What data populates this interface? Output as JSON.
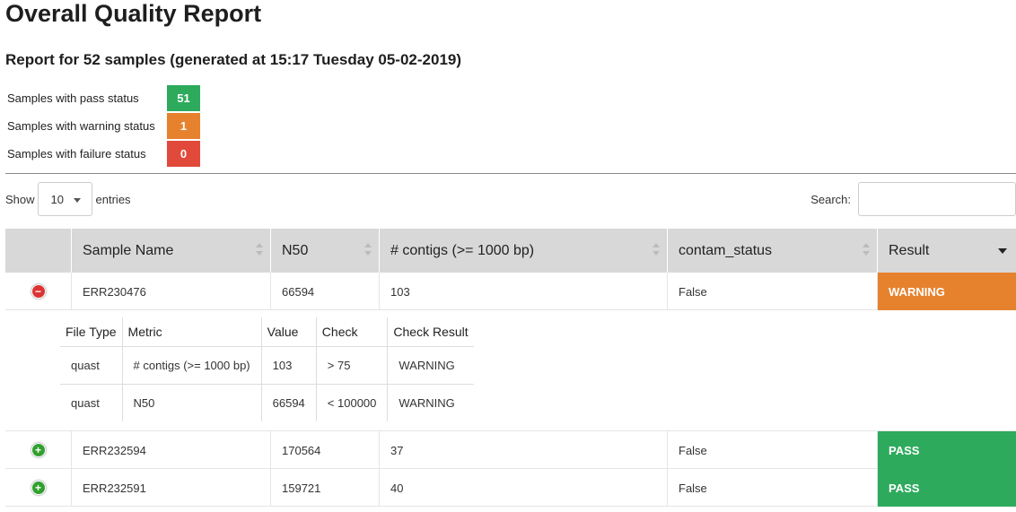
{
  "page": {
    "title": "Overall Quality Report",
    "subtitle": "Report for 52 samples (generated at 15:17 Tuesday 05-02-2019)"
  },
  "summary": [
    {
      "label": "Samples with pass status",
      "count": "51",
      "color": "#2eaa5d"
    },
    {
      "label": "Samples with warning status",
      "count": "1",
      "color": "#e6822e"
    },
    {
      "label": "Samples with failure status",
      "count": "0",
      "color": "#e14a3b"
    }
  ],
  "controls": {
    "show_label": "Show",
    "page_length": "10",
    "entries_label": "entries",
    "search_label": "Search:",
    "search_value": ""
  },
  "table": {
    "columns": [
      "",
      "Sample Name",
      "N50",
      "# contigs (>= 1000 bp)",
      "contam_status",
      "Result"
    ],
    "sorted_column": "Result",
    "rows": [
      {
        "toggle": "−",
        "sample": "ERR230476",
        "n50": "66594",
        "contigs": "103",
        "contam": "False",
        "result": "WARNING",
        "result_color": "#e6822e",
        "expanded": true
      },
      {
        "toggle": "+",
        "sample": "ERR232594",
        "n50": "170564",
        "contigs": "37",
        "contam": "False",
        "result": "PASS",
        "result_color": "#2eaa5d",
        "expanded": false
      },
      {
        "toggle": "+",
        "sample": "ERR232591",
        "n50": "159721",
        "contigs": "40",
        "contam": "False",
        "result": "PASS",
        "result_color": "#2eaa5d",
        "expanded": false
      }
    ]
  },
  "details": {
    "columns": [
      "File Type",
      "Metric",
      "Value",
      "Check",
      "Check Result"
    ],
    "rows": [
      {
        "file_type": "quast",
        "metric": "# contigs (>= 1000 bp)",
        "value": "103",
        "check": "> 75",
        "check_result": "WARNING"
      },
      {
        "file_type": "quast",
        "metric": "N50",
        "value": "66594",
        "check": "< 100000",
        "check_result": "WARNING"
      }
    ]
  }
}
